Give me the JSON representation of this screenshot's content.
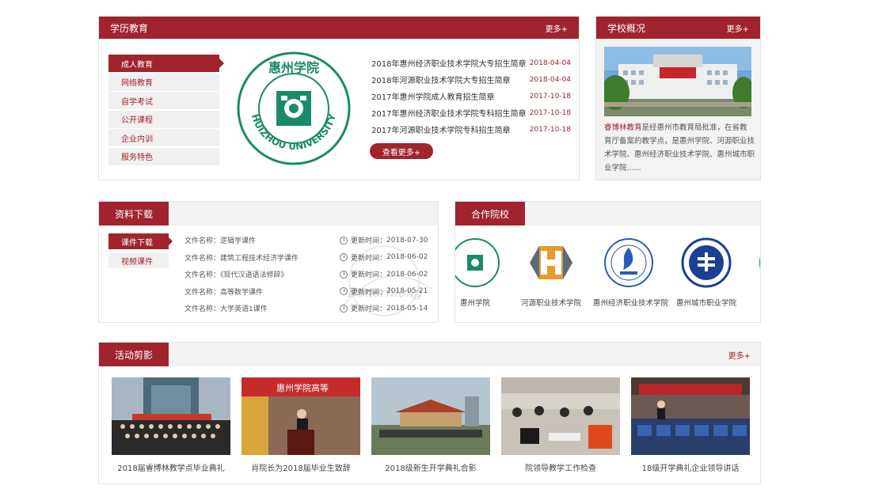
{
  "edu": {
    "title": "学历教育",
    "more": "更多+",
    "menu": [
      "成人教育",
      "网络教育",
      "自学考试",
      "公开课程",
      "企业内训",
      "服务特色"
    ],
    "logo_text": "HUIZHOU UNIVERSITY",
    "logo_cn": "惠州学院",
    "news": [
      {
        "title": "2018年惠州经济职业技术学院大专招生简章",
        "date": "2018-04-04"
      },
      {
        "title": "2018年河源职业技术学院大专招生简章",
        "date": "2018-04-04"
      },
      {
        "title": "2017年惠州学院成人教育招生简章",
        "date": "2017-10-18"
      },
      {
        "title": "2017年惠州经济职业技术学院专科招生简章",
        "date": "2017-10-18"
      },
      {
        "title": "2017年河源职业技术学院专科招生简章",
        "date": "2017-10-18"
      }
    ],
    "view_more": "查看更多+"
  },
  "overview": {
    "title": "学校概况",
    "more": "更多+",
    "text_highlight": "睿博林教育",
    "text_rest": "是经惠州市教育局批准，在省教育厅备案的教学点，是惠州学院、河源职业技术学院、惠州经济职业技术学院、惠州城市职业学院......"
  },
  "download": {
    "title": "资料下载",
    "menu": [
      "课件下载",
      "视频课件"
    ],
    "files": [
      {
        "label": "文件名称：",
        "name": "逻辑学课件",
        "time_label": "更新时间：",
        "time": "2018-07-30"
      },
      {
        "label": "文件名称：",
        "name": "建筑工程技术经济学课件",
        "time_label": "更新时间：",
        "time": "2018-06-02"
      },
      {
        "label": "文件名称：",
        "name": "《现代汉语语法修辞》",
        "time_label": "更新时间：",
        "time": "2018-06-02"
      },
      {
        "label": "文件名称：",
        "name": "高等数学课件",
        "time_label": "更新时间：",
        "time": "2018-05-21"
      },
      {
        "label": "文件名称：",
        "name": "大学英语1课件",
        "time_label": "更新时间：",
        "time": "2018-05-14"
      }
    ],
    "watermark": "Bonerhiong"
  },
  "partner": {
    "title": "合作院校",
    "schools": [
      "惠州学院",
      "河源职业技术学院",
      "惠州经济职业技术学院",
      "惠州城市职业学院"
    ]
  },
  "activity": {
    "title": "活动剪影",
    "more": "更多+",
    "items": [
      {
        "caption": "2018届睿博林教学点毕业典礼"
      },
      {
        "caption": "肖院长为2018届毕业生致辞",
        "banner": "惠州学院高等"
      },
      {
        "caption": "2018级新生开学典礼合影"
      },
      {
        "caption": "院领导教学工作检查"
      },
      {
        "caption": "18级开学典礼企业领导讲话"
      }
    ]
  },
  "colors": {
    "brand": "#a0232e",
    "logo_green": "#1a8a6a"
  }
}
